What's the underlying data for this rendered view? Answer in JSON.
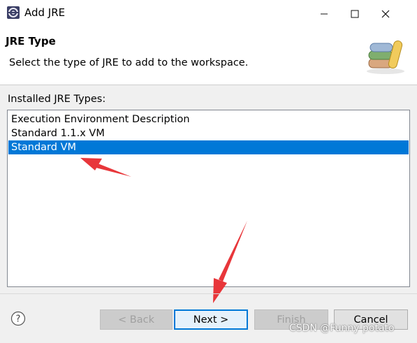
{
  "window": {
    "title": "Add JRE"
  },
  "header": {
    "title": "JRE Type",
    "description": "Select the type of JRE to add to the workspace."
  },
  "list": {
    "label": "Installed JRE Types:",
    "items": [
      "Execution Environment Description",
      "Standard 1.1.x VM",
      "Standard VM"
    ],
    "selected": "Standard VM"
  },
  "buttons": {
    "back": "< Back",
    "next": "Next >",
    "finish": "Finish",
    "cancel": "Cancel"
  },
  "watermark": "CSDN @Funny potato",
  "colors": {
    "selection": "#0078d7",
    "annotation_arrow": "#e8363a"
  },
  "icons": {
    "app": "eclipse-icon",
    "header": "books-icon",
    "help": "help-icon"
  }
}
